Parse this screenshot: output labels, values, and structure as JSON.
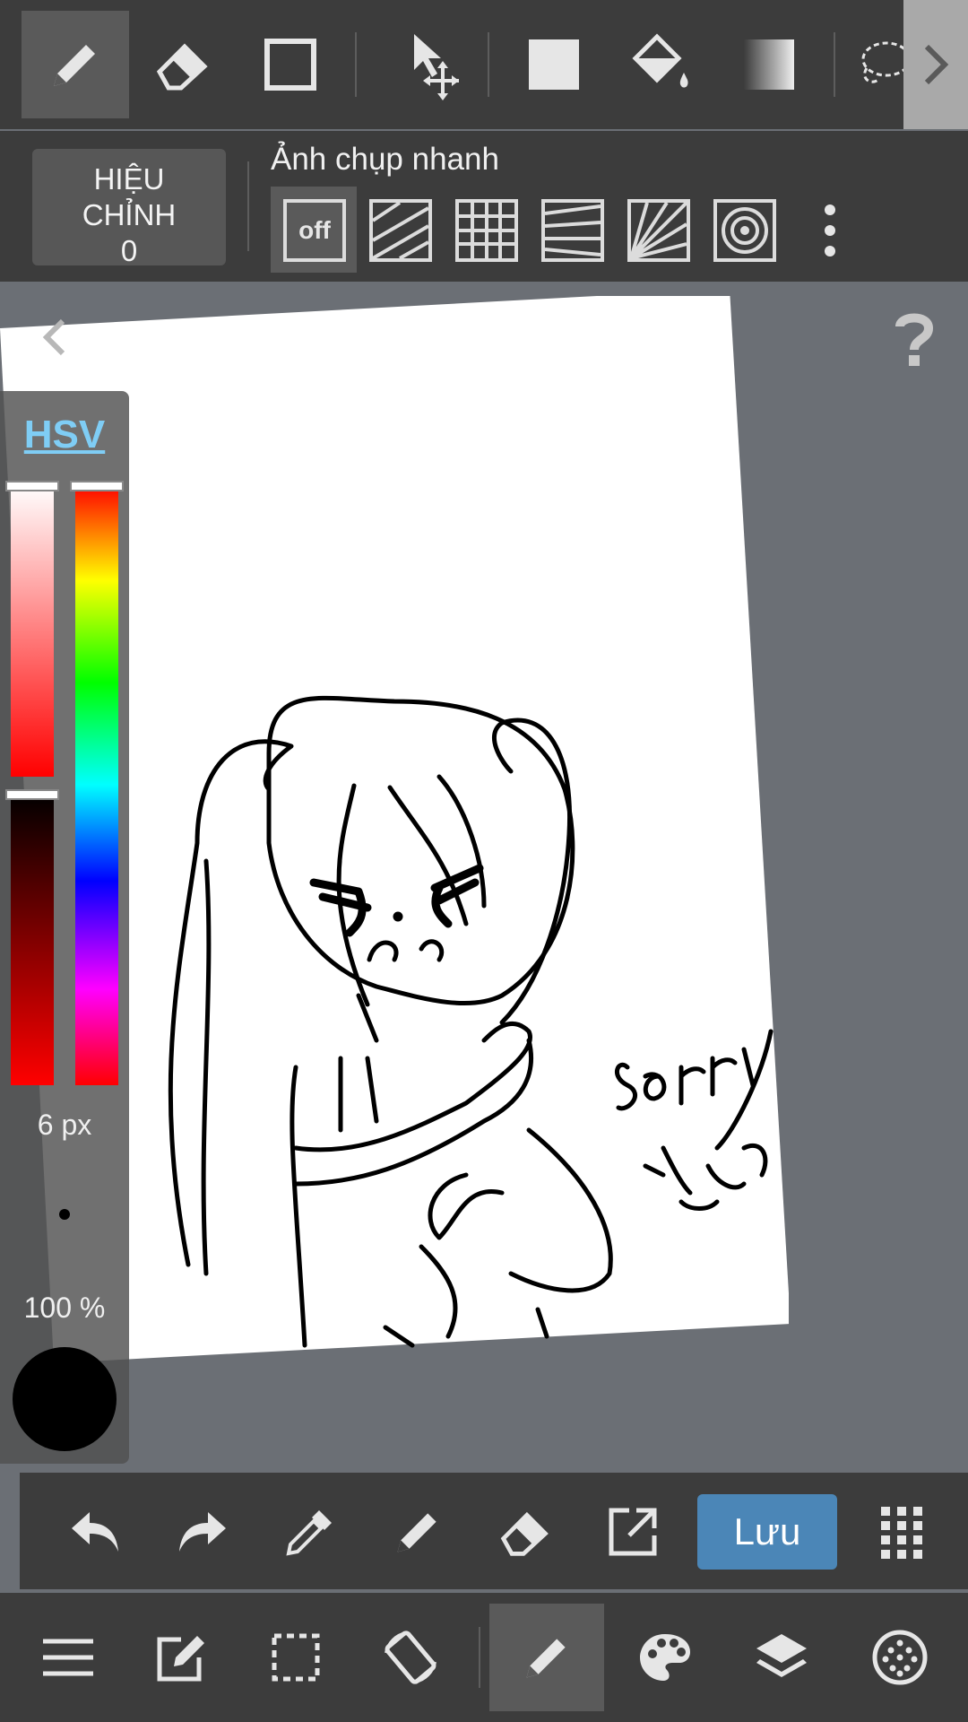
{
  "toolbar": {
    "tools": [
      "pen-tool",
      "eraser-tool",
      "rectangle-tool",
      "move-tool",
      "fill-tool",
      "bucket-tool",
      "gradient-tool",
      "lasso-tool"
    ],
    "active_tool": "pen-tool"
  },
  "snap_bar": {
    "correction_line1": "HIỆU",
    "correction_line2": "CHỈNH",
    "correction_line3": "0",
    "title": "Ảnh chụp nhanh",
    "off_label": "off",
    "snaps": [
      "snap-off",
      "snap-parallel",
      "snap-grid",
      "snap-perspective-lines",
      "snap-radial",
      "snap-circle"
    ]
  },
  "color_panel": {
    "mode_label": "HSV",
    "brush_size": "6 px",
    "opacity": "100 %",
    "current_color": "#000000"
  },
  "canvas": {
    "signature_text": "sorry"
  },
  "action_bar": {
    "save_label": "Lưu"
  },
  "colors": {
    "bar_bg": "#3c3c3c",
    "accent": "#4b86b7",
    "hsv_link": "#7fcdf5"
  }
}
